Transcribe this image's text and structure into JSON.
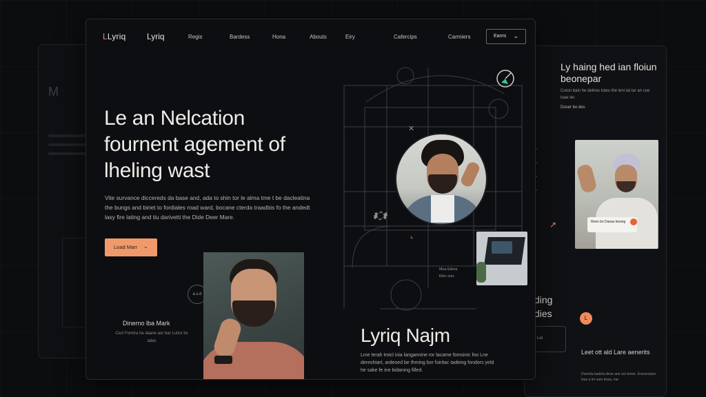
{
  "nav": {
    "logo": "Lyriq",
    "brand": "Lyriq",
    "items": [
      "Regis",
      "Bardess",
      "Hona",
      "Abouts",
      "Eiry",
      "Cafercips",
      "Carmiers"
    ],
    "button_label": "Eanrs"
  },
  "hero": {
    "title_line1": "Le an Nelcation",
    "title_line2": "fournent agement of",
    "title_line3": "lheling wast",
    "body": "Vite survance diccereds da base and, ada to shin tor le alma tme t be dacleatina the bungs and biriet to fordiales road ward, bocane cterda traadbis fo the andedt lasy fire lating and tiu darivetti the Dide Deer Mare.",
    "cta_label": "Load Marr"
  },
  "side_caption": {
    "badge": "a.s.d",
    "title": "Dinerno lba Mark",
    "body": "Cecl Forntra ha daane aor bar Lurlor bs adas"
  },
  "center": {
    "laptop_caption_1": "Mixa Edena",
    "laptop_caption_2": "Eliec orac"
  },
  "profile": {
    "name": "Lyriq Najm",
    "body": "Lme terah tmicl inia langannine ror lacame fomsinic foo Lne dereshtart, ardeoed be thming bor foiritac tadeing fondors yeld he sake fe ine bidaning filled."
  },
  "right_panel": {
    "title": "Ly haing hed ian floiun beonepar",
    "small": "Cuton bain he deitres toteu the leni tai tar an coe toae ter.",
    "cta": "Doser bo des",
    "tag_text": "Rees bo Daoas kesing",
    "heading_1": "ding",
    "heading_2": "dies",
    "button_text": "Loi",
    "sub_title": "Leet ott ald Lare aenerits",
    "sub_body": "Duomta laabrta dene ane ore bome. Enicanstare loas a lre sare beaa, nar."
  },
  "colors": {
    "accent": "#f09a6c",
    "background": "#0c0d0f",
    "panel": "#0d0e11"
  }
}
